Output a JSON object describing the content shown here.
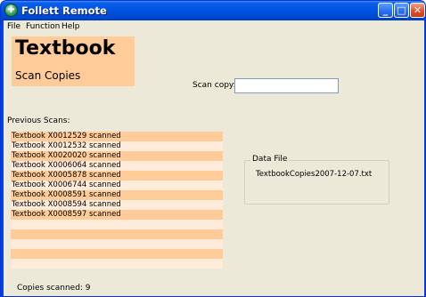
{
  "window": {
    "title": "Follett Remote",
    "icon": "follett-app-icon",
    "controls": {
      "minimize": "_",
      "maximize": "□",
      "close": "✕"
    }
  },
  "menu": {
    "items": [
      {
        "label": "File"
      },
      {
        "label": "Function"
      },
      {
        "label": "Help"
      }
    ]
  },
  "header": {
    "title": "Textbook",
    "subtitle": "Scan Copies"
  },
  "scan": {
    "label": "Scan copy:",
    "value": ""
  },
  "previous_scans": {
    "label": "Previous Scans:",
    "rows": [
      "Textbook X0012529 scanned",
      "Textbook X0012532 scanned",
      "Textbook X0020020 scanned",
      "Textbook X0006064 scanned",
      "Textbook X0005878 scanned",
      "Textbook X0006744 scanned",
      "Textbook X0008591 scanned",
      "Textbook X0008594 scanned",
      "Textbook X0008597 scanned",
      "",
      "",
      "",
      "",
      ""
    ]
  },
  "data_file": {
    "legend": "Data File",
    "filename": "TextbookCopies2007-12-07.txt"
  },
  "status": {
    "copies_scanned": "Copies scanned: 9"
  },
  "colors": {
    "accent": "#ffcc99",
    "row_alt": "#ffebd9",
    "window_bg": "#ece9d8",
    "titlebar": "#0053e0"
  }
}
